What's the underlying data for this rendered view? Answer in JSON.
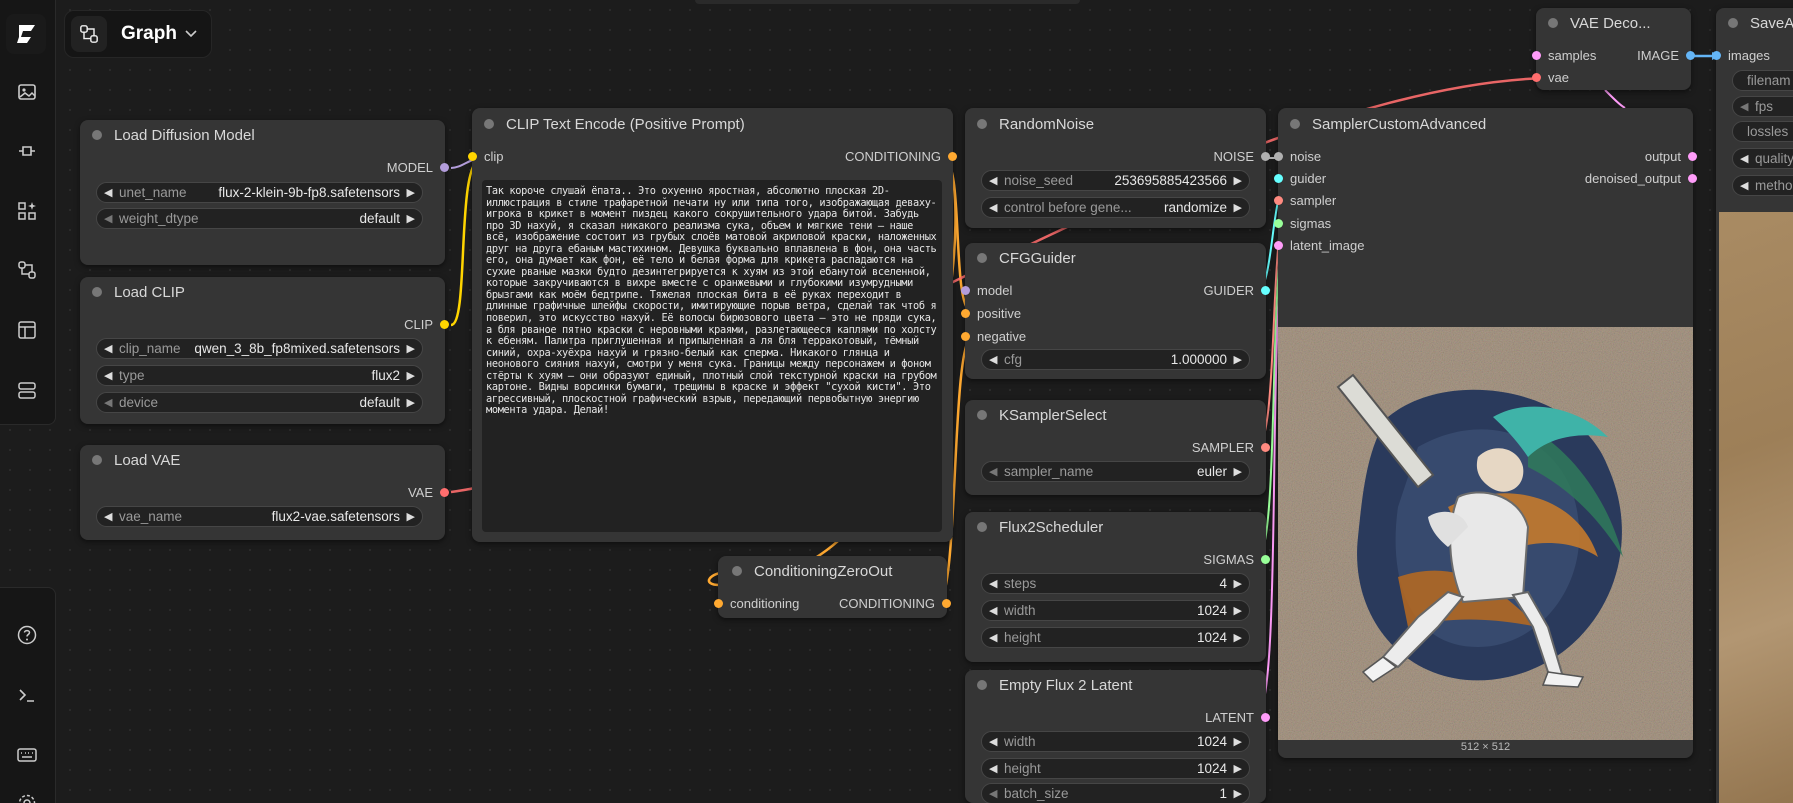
{
  "toolbar": {
    "graph_label": "Graph"
  },
  "sidebar": {
    "top_icons": [
      "images-icon",
      "model-library-icon",
      "nodes-library-icon",
      "workflows-icon",
      "templates-icon",
      "queue-icon"
    ],
    "bottom_icons": [
      "help-icon",
      "terminal-icon",
      "keyboard-icon",
      "settings-icon"
    ]
  },
  "nodes": {
    "load_diffusion": {
      "title": "Load Diffusion Model",
      "output": "MODEL",
      "unet_name_label": "unet_name",
      "unet_name_value": "flux-2-klein-9b-fp8.safetensors",
      "weight_dtype_label": "weight_dtype",
      "weight_dtype_value": "default"
    },
    "load_clip": {
      "title": "Load CLIP",
      "output": "CLIP",
      "clip_name_label": "clip_name",
      "clip_name_value": "qwen_3_8b_fp8mixed.safetensors",
      "type_label": "type",
      "type_value": "flux2",
      "device_label": "device",
      "device_value": "default"
    },
    "load_vae": {
      "title": "Load VAE",
      "output": "VAE",
      "vae_name_label": "vae_name",
      "vae_name_value": "flux2-vae.safetensors"
    },
    "clip_text": {
      "title": "CLIP Text Encode (Positive Prompt)",
      "input": "clip",
      "output": "CONDITIONING",
      "text": "Так короче слушай ёпата.. Это охуенно яростная, абсолютно плоская 2D-иллюстрация в стиле трафаретной печати ну или типа того, изображающая деваху-игрока в крикет в момент пиздец какого сокрушительного удара битой. Забудь про 3D нахуй, я сказал никакого реализма сука, объем и мягкие тени — наше всё, изображение состоит из грубых слоёв матовой акриловой краски, наложенных друг на друга ебаным мастихином. Девушка буквально вплавлена в фон, она часть его, она думает как фон, её тело и белая форма для крикета распадаются на сухие рваные мазки будто дезинтегрируется к хуям из этой ебанутой вселенной, которые закручиваются в вихре вместе с оранжевыми и глубокими изумрудными брызгами как моём бедтрипе. Тяжелая плоская бита в её руках переходит в длинные графичные шлейфы скорости, имитирующие порыв ветра, сделай так чтоб я поверил, это искусство нахуй. Её волосы бирюзового цвета — это не пряди сука, а бля рваное пятно краски с неровными краями, разлетающееся каплями по холсту к ебеням. Палитра приглушенная и припыленная а ля бля терракотовый, тёмный синий, охра-хуёхра нахуй и грязно-белый как сперма. Никакого глянца и неонового сияния нахуй, смотри у меня сука. Границы между персонажем и фоном стёрты к хуям — они образуют единый, плотный слой текстурной краски на грубом картоне. Видны ворсинки бумаги, трещины в краске и эффект \"сухой кисти\". Это агрессивный, плоскостной графический взрыв, передающий первобытную энергию момента удара. Делай!"
    },
    "cond_zero": {
      "title": "ConditioningZeroOut",
      "input": "conditioning",
      "output": "CONDITIONING"
    },
    "random_noise": {
      "title": "RandomNoise",
      "output": "NOISE",
      "noise_seed_label": "noise_seed",
      "noise_seed_value": "253695885423566",
      "control_label": "control before gene...",
      "control_value": "randomize"
    },
    "cfg_guider": {
      "title": "CFGGuider",
      "inputs": [
        "model",
        "positive",
        "negative"
      ],
      "output": "GUIDER",
      "cfg_label": "cfg",
      "cfg_value": "1.000000"
    },
    "ksampler_select": {
      "title": "KSamplerSelect",
      "output": "SAMPLER",
      "sampler_name_label": "sampler_name",
      "sampler_name_value": "euler"
    },
    "flux2_scheduler": {
      "title": "Flux2Scheduler",
      "output": "SIGMAS",
      "steps_label": "steps",
      "steps_value": "4",
      "width_label": "width",
      "width_value": "1024",
      "height_label": "height",
      "height_value": "1024"
    },
    "empty_latent": {
      "title": "Empty Flux 2 Latent",
      "output": "LATENT",
      "width_label": "width",
      "width_value": "1024",
      "height_label": "height",
      "height_value": "1024",
      "batch_size_label": "batch_size",
      "batch_size_value": "1"
    },
    "sampler_custom": {
      "title": "SamplerCustomAdvanced",
      "inputs": [
        "noise",
        "guider",
        "sampler",
        "sigmas",
        "latent_image"
      ],
      "outputs": [
        "output",
        "denoised_output"
      ],
      "preview_caption": "512 × 512"
    },
    "vae_decode": {
      "title": "VAE Deco...",
      "inputs": [
        "samples",
        "vae"
      ],
      "output": "IMAGE"
    },
    "save": {
      "title": "SaveA",
      "input": "images",
      "widgets": [
        "filenam",
        "fps",
        "lossles",
        "quality",
        "metho"
      ]
    }
  },
  "colors": {
    "model": "#b39ddb",
    "clip": "#ffd500",
    "vae": "#ff6e6e",
    "conditioning": "#ffa931",
    "noise": "#b0b0b0",
    "guider": "#66ffff",
    "sampler": "#ff8a80",
    "sigmas": "#99ff99",
    "latent": "#ff9cf9",
    "image": "#64b5f6"
  }
}
